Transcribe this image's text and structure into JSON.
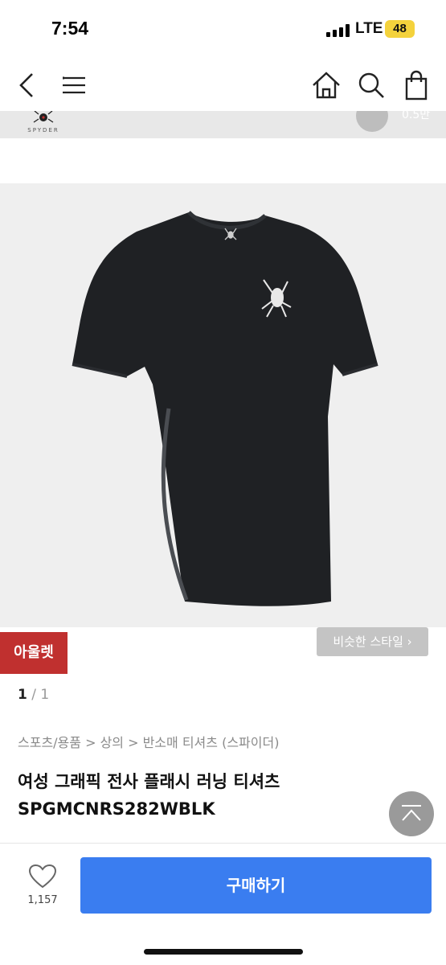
{
  "status_bar": {
    "time": "7:54",
    "network": "LTE",
    "battery": "48"
  },
  "brand": {
    "logo_text": "SPYDER",
    "corner_text": "0.5만"
  },
  "badges": {
    "outlet": "아울렛",
    "similar_style": "비슷한 스타일 ›"
  },
  "gallery": {
    "current": "1",
    "separator": " / ",
    "total": "1"
  },
  "breadcrumb": "스포츠/용품 > 상의 > 반소매 티셔츠 (스파이더)",
  "product": {
    "title_line1": "여성 그래픽 전사 플래시 러닝 티셔츠",
    "title_line2": "SPGMCNRS282WBLK"
  },
  "bottom_bar": {
    "like_count": "1,157",
    "buy_label": "구매하기"
  },
  "colors": {
    "accent": "#3a7df0",
    "outlet": "#c0302f",
    "shirt": "#1f2124"
  }
}
